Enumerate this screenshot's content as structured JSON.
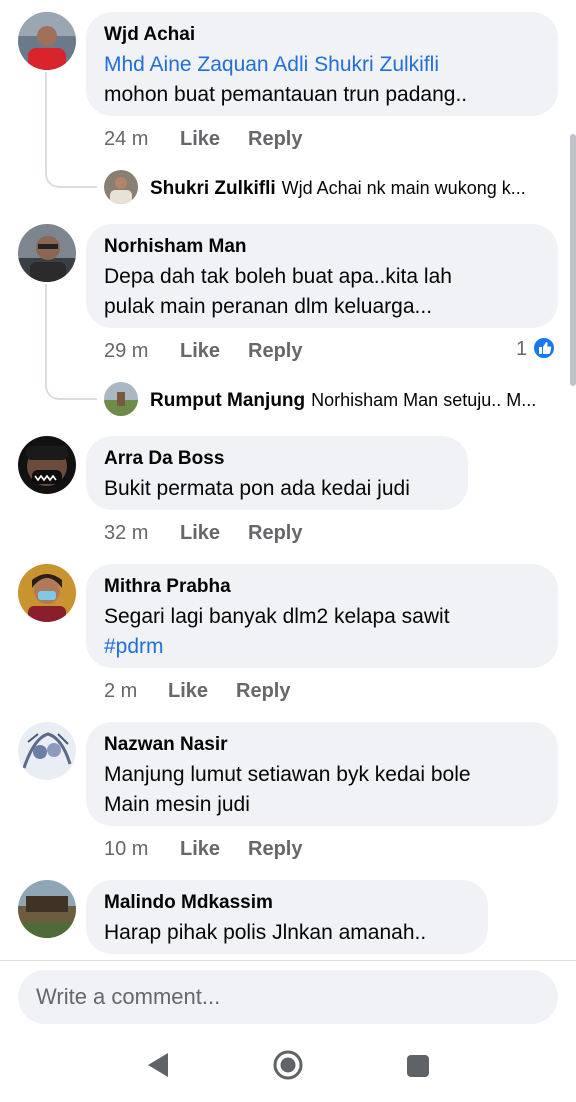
{
  "comments": [
    {
      "author": "Wjd Achai",
      "mention": "Mhd Aine Zaquan Adli Shukri Zulkifli",
      "text": "mohon buat pemantauan trun padang..",
      "time": "24 m",
      "like": "Like",
      "reply": "Reply",
      "reply_preview": {
        "author": "Shukri Zulkifli",
        "text": "Wjd Achai  nk main wukong k..."
      }
    },
    {
      "author": "Norhisham Man",
      "text_lines": [
        "Depa dah tak boleh buat apa..kita lah",
        "pulak main peranan dlm keluarga..."
      ],
      "time": "29 m",
      "like": "Like",
      "reply": "Reply",
      "reaction_count": "1",
      "reply_preview": {
        "author": "Rumput Manjung",
        "text": "Norhisham Man setuju.. M..."
      }
    },
    {
      "author": "Arra Da Boss",
      "text": "Bukit permata pon ada kedai judi",
      "time": "32 m",
      "like": "Like",
      "reply": "Reply"
    },
    {
      "author": "Mithra Prabha",
      "text": "Segari lagi banyak dlm2 kelapa sawit",
      "hashtag": "#pdrm",
      "time": "2 m",
      "like": "Like",
      "reply": "Reply"
    },
    {
      "author": "Nazwan Nasir",
      "text_lines": [
        "Manjung lumut setiawan byk kedai bole",
        "Main mesin judi"
      ],
      "time": "10 m",
      "like": "Like",
      "reply": "Reply"
    },
    {
      "author": "Malindo Mdkassim",
      "text": "Harap pihak polis Jlnkan amanah.."
    }
  ],
  "composer": {
    "placeholder": "Write a comment..."
  },
  "icons": {
    "like_badge": "thumbs-up-icon",
    "nav": [
      "back-triangle-icon",
      "home-circle-icon",
      "recents-square-icon"
    ]
  },
  "colors": {
    "mention": "#216fdb",
    "bubble": "#f0f2f5",
    "meta": "#65676b",
    "like_badge": "#1877f2"
  }
}
